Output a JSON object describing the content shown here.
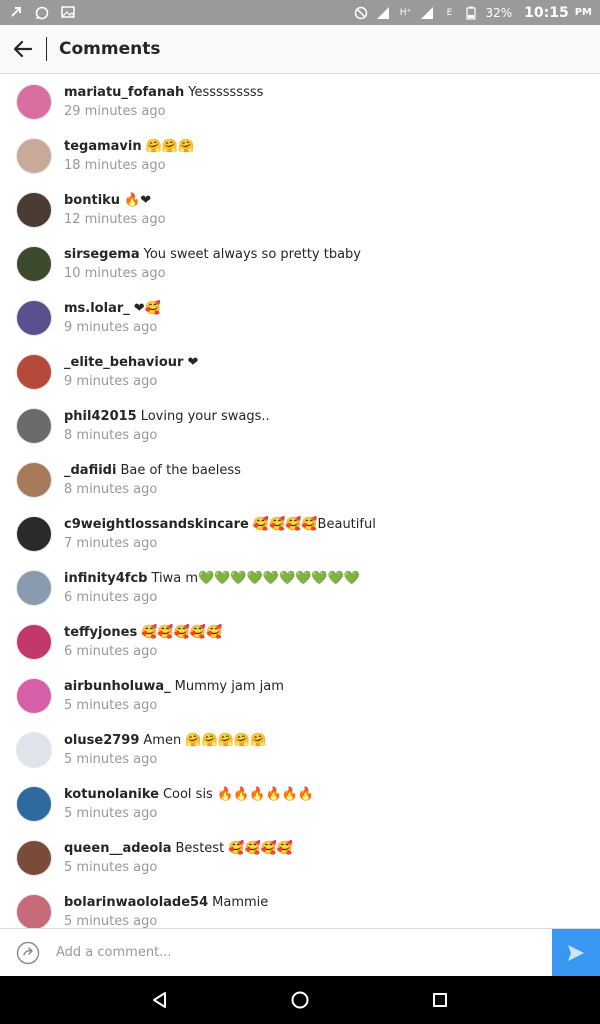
{
  "status_bar": {
    "icons_left": [
      "notification-icon",
      "whatsapp-icon",
      "gallery-icon"
    ],
    "icons_right": [
      "do-not-disturb-icon",
      "signal-icon",
      "data-icon",
      "signal-icon",
      "network-e-icon",
      "battery-icon"
    ],
    "network_label": "E",
    "battery_percent": "32%",
    "time": "10:15",
    "ampm": "PM"
  },
  "header": {
    "title": "Comments"
  },
  "comments": [
    {
      "username": "mariatu_fofanah",
      "text": "Yesssssssss",
      "time": "29 minutes ago",
      "avatar_color": "#d96fa0"
    },
    {
      "username": "tegamavin",
      "text": "🤗🤗🤗",
      "time": "18 minutes ago",
      "avatar_color": "#c9a99a"
    },
    {
      "username": "bontiku",
      "text": "🔥❤",
      "time": "12 minutes ago",
      "avatar_color": "#4a3b33"
    },
    {
      "username": "sirsegema",
      "text": "You sweet always so pretty tbaby",
      "time": "10 minutes ago",
      "avatar_color": "#3b4a2c"
    },
    {
      "username": "ms.lolar_",
      "text": "❤🥰",
      "time": "9 minutes ago",
      "avatar_color": "#5a4f8f"
    },
    {
      "username": "_elite_behaviour",
      "text": "❤",
      "time": "9 minutes ago",
      "avatar_color": "#b54a3a"
    },
    {
      "username": "phil42015",
      "text": "Loving your swags..",
      "time": "8 minutes ago",
      "avatar_color": "#6b6b6b"
    },
    {
      "username": "_dafiidi",
      "text": "Bae of the baeless",
      "time": "8 minutes ago",
      "avatar_color": "#a87a5c"
    },
    {
      "username": "c9weightlossandskincare",
      "text": "🥰🥰🥰🥰Beautiful",
      "time": "7 minutes ago",
      "avatar_color": "#2a2a2a"
    },
    {
      "username": "infinity4fcb",
      "text": "Tiwa m💚💚💚💚💚💚💚💚💚💚",
      "time": "6 minutes ago",
      "avatar_color": "#8a9bb0"
    },
    {
      "username": "teffyjones",
      "text": "🥰🥰🥰🥰🥰",
      "time": "6 minutes ago",
      "avatar_color": "#c2386b"
    },
    {
      "username": "airbunholuwa_",
      "text": "Mummy jam jam",
      "time": "5 minutes ago",
      "avatar_color": "#d65fa8"
    },
    {
      "username": "oluse2799",
      "text": "Amen 🤗🤗🤗🤗🤗",
      "time": "5 minutes ago",
      "avatar_color": "#dfe3ea"
    },
    {
      "username": "kotunolanike",
      "text": "Cool sis 🔥🔥🔥🔥🔥🔥",
      "time": "5 minutes ago",
      "avatar_color": "#2f6a9e"
    },
    {
      "username": "queen__adeola",
      "text": "Bestest 🥰🥰🥰🥰",
      "time": "5 minutes ago",
      "avatar_color": "#7a4a3a"
    },
    {
      "username": "bolarinwaololade54",
      "text": "Mammie",
      "time": "5 minutes ago",
      "avatar_color": "#c76a7a"
    }
  ],
  "composer": {
    "placeholder": "Add a comment..."
  },
  "colors": {
    "accent": "#3897f0",
    "text_primary": "#262626",
    "text_secondary": "#999999"
  }
}
